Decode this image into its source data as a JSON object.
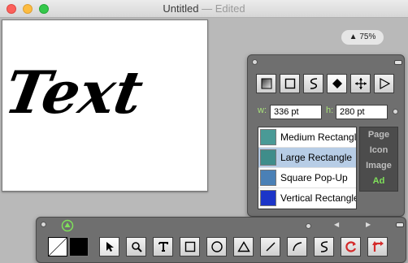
{
  "window": {
    "title": "Untitled",
    "title_sep": "—",
    "title_status": "Edited"
  },
  "canvas": {
    "text": "Text"
  },
  "zoom": {
    "label": "▲ 75%"
  },
  "props": {
    "width_label": "w:",
    "width_value": "336 pt",
    "height_label": "h:",
    "height_value": "280 pt",
    "shape_tools": [
      "gradient-tool-icon",
      "rectangle-tool-icon",
      "path-tool-icon",
      "diamond-tool-icon",
      "move-tool-icon",
      "play-tool-icon"
    ],
    "templates": [
      {
        "label": "Medium Rectangle",
        "color": "#4a9a96",
        "selected": false
      },
      {
        "label": "Large Rectangle",
        "color": "#3f8d8a",
        "selected": true
      },
      {
        "label": "Square Pop-Up",
        "color": "#4a80b6",
        "selected": false
      },
      {
        "label": "Vertical Rectangle",
        "color": "#1c35c8",
        "selected": false
      }
    ],
    "categories": [
      {
        "label": "Page",
        "active": false
      },
      {
        "label": "Icon",
        "active": false
      },
      {
        "label": "Image",
        "active": false
      },
      {
        "label": "Ad",
        "active": true
      }
    ]
  },
  "tools": {
    "items": [
      "pointer-tool-icon",
      "zoom-tool-icon",
      "text-tool-icon",
      "rectangle-tool-icon",
      "oval-tool-icon",
      "triangle-tool-icon",
      "line-tool-icon",
      "arc-tool-icon",
      "pen-tool-icon",
      "rotate-tool-icon",
      "transform-tool-icon"
    ],
    "accent": "#7fe05a"
  }
}
